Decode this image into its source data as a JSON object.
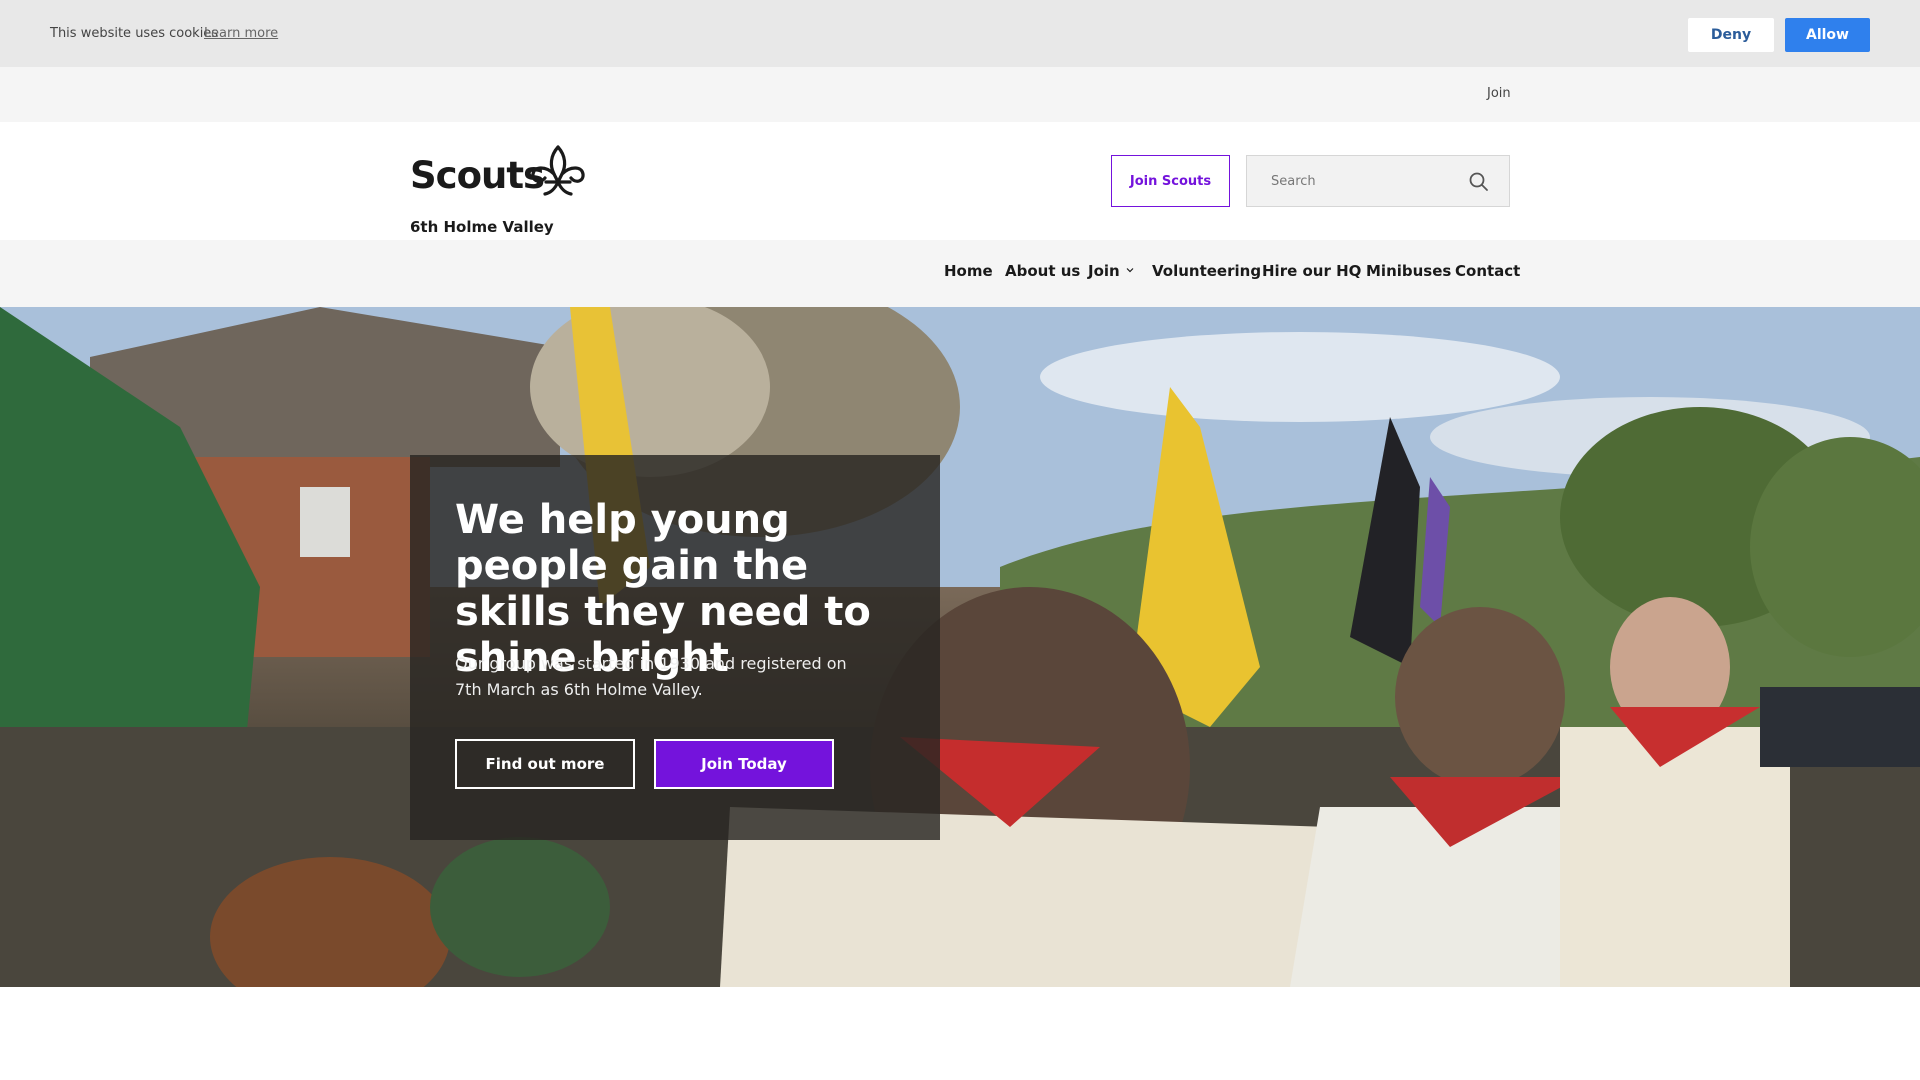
{
  "cookie_bar": {
    "message": "This website uses cookies",
    "learn_more": "Learn more",
    "deny_label": "Deny",
    "allow_label": "Allow"
  },
  "utility_bar": {
    "join_link": "Join"
  },
  "header": {
    "logo_word": "Scouts",
    "group_name": "6th Holme Valley",
    "join_button": "Join Scouts",
    "search_placeholder": "Search"
  },
  "nav": {
    "items": [
      {
        "label": "Home"
      },
      {
        "label": "About us"
      },
      {
        "label": "Join"
      },
      {
        "label": "Volunteering"
      },
      {
        "label": "Hire our HQ"
      },
      {
        "label": "Minibuses"
      },
      {
        "label": "Contact"
      }
    ]
  },
  "hero": {
    "title": "We help young people gain the skills they need to shine bright",
    "text": "Our group was started in 1930 and registered on 7th March as 6th Holme Valley.",
    "find_out_more": "Find out more",
    "join_today": "Join Today"
  },
  "colors": {
    "brand_purple": "#7413dc",
    "allow_blue": "#2f80ed",
    "cookie_bg": "#e8e8e8",
    "nav_bg": "#f5f5f5"
  },
  "icons": {
    "logo": "fleur-de-lis-icon",
    "search": "search-icon",
    "dropdown": "chevron-down-icon"
  }
}
